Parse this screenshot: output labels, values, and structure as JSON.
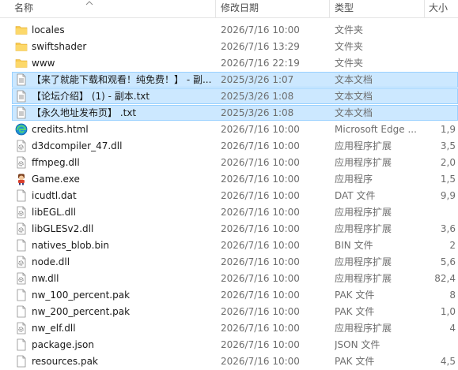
{
  "columns": {
    "name": "名称",
    "date": "修改日期",
    "type": "类型",
    "size": "大小"
  },
  "files": [
    {
      "name": "locales",
      "date": "2026/7/16 10:00",
      "type": "文件夹",
      "size": "",
      "icon": "folder-icon",
      "selected": false
    },
    {
      "name": "swiftshader",
      "date": "2026/7/16 13:29",
      "type": "文件夹",
      "size": "",
      "icon": "folder-icon",
      "selected": false
    },
    {
      "name": "www",
      "date": "2026/7/16 22:19",
      "type": "文件夹",
      "size": "",
      "icon": "folder-icon",
      "selected": false
    },
    {
      "name": "【来了就能下载和观看！纯免费！】 - 副...",
      "date": "2025/3/26 1:07",
      "type": "文本文档",
      "size": "",
      "icon": "text-file-icon",
      "selected": true
    },
    {
      "name": "【论坛介绍】 (1) - 副本.txt",
      "date": "2025/3/26 1:08",
      "type": "文本文档",
      "size": "",
      "icon": "text-file-icon",
      "selected": true
    },
    {
      "name": "【永久地址发布页】 .txt",
      "date": "2025/3/26 1:08",
      "type": "文本文档",
      "size": "",
      "icon": "text-file-icon",
      "selected": true
    },
    {
      "name": "credits.html",
      "date": "2026/7/16 10:00",
      "type": "Microsoft Edge ...",
      "size": "1,9",
      "icon": "edge-icon",
      "selected": false
    },
    {
      "name": "d3dcompiler_47.dll",
      "date": "2026/7/16 10:00",
      "type": "应用程序扩展",
      "size": "3,5",
      "icon": "dll-file-icon",
      "selected": false
    },
    {
      "name": "ffmpeg.dll",
      "date": "2026/7/16 10:00",
      "type": "应用程序扩展",
      "size": "2,0",
      "icon": "dll-file-icon",
      "selected": false
    },
    {
      "name": "Game.exe",
      "date": "2026/7/16 10:00",
      "type": "应用程序",
      "size": "1,5",
      "icon": "game-exe-icon",
      "selected": false
    },
    {
      "name": "icudtl.dat",
      "date": "2026/7/16 10:00",
      "type": "DAT 文件",
      "size": "9,9",
      "icon": "blank-file-icon",
      "selected": false
    },
    {
      "name": "libEGL.dll",
      "date": "2026/7/16 10:00",
      "type": "应用程序扩展",
      "size": "",
      "icon": "dll-file-icon",
      "selected": false
    },
    {
      "name": "libGLESv2.dll",
      "date": "2026/7/16 10:00",
      "type": "应用程序扩展",
      "size": "3,6",
      "icon": "dll-file-icon",
      "selected": false
    },
    {
      "name": "natives_blob.bin",
      "date": "2026/7/16 10:00",
      "type": "BIN 文件",
      "size": "2",
      "icon": "blank-file-icon",
      "selected": false
    },
    {
      "name": "node.dll",
      "date": "2026/7/16 10:00",
      "type": "应用程序扩展",
      "size": "5,6",
      "icon": "dll-file-icon",
      "selected": false
    },
    {
      "name": "nw.dll",
      "date": "2026/7/16 10:00",
      "type": "应用程序扩展",
      "size": "82,4",
      "icon": "dll-file-icon",
      "selected": false
    },
    {
      "name": "nw_100_percent.pak",
      "date": "2026/7/16 10:00",
      "type": "PAK 文件",
      "size": "8",
      "icon": "blank-file-icon",
      "selected": false
    },
    {
      "name": "nw_200_percent.pak",
      "date": "2026/7/16 10:00",
      "type": "PAK 文件",
      "size": "1,0",
      "icon": "blank-file-icon",
      "selected": false
    },
    {
      "name": "nw_elf.dll",
      "date": "2026/7/16 10:00",
      "type": "应用程序扩展",
      "size": "4",
      "icon": "dll-file-icon",
      "selected": false
    },
    {
      "name": "package.json",
      "date": "2026/7/16 10:00",
      "type": "JSON 文件",
      "size": "",
      "icon": "blank-file-icon",
      "selected": false
    },
    {
      "name": "resources.pak",
      "date": "2026/7/16 10:00",
      "type": "PAK 文件",
      "size": "4,5",
      "icon": "blank-file-icon",
      "selected": false
    }
  ],
  "colors": {
    "selection_fill": "#cce8ff",
    "selection_border": "#99d1ff",
    "folder": "#f8c94d",
    "edge": "#1f8fd6"
  }
}
